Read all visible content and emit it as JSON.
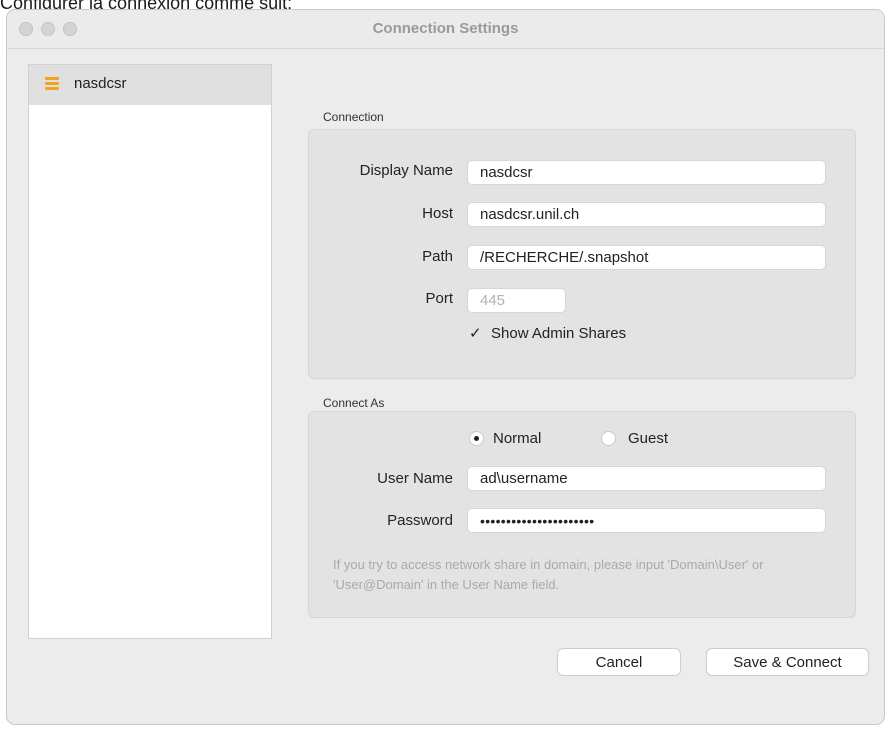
{
  "caption": "Configurer la connexion comme suit:",
  "window": {
    "title": "Connection Settings"
  },
  "sidebar": {
    "items": [
      {
        "label": "nasdcsr"
      }
    ]
  },
  "connection": {
    "section_label": "Connection",
    "display_name": {
      "label": "Display Name",
      "value": "nasdcsr"
    },
    "host": {
      "label": "Host",
      "value": "nasdcsr.unil.ch"
    },
    "path": {
      "label": "Path",
      "value": "/RECHERCHE/.snapshot"
    },
    "port": {
      "label": "Port",
      "placeholder": "445"
    },
    "show_admin_shares": {
      "label": "Show Admin Shares",
      "checked": true
    }
  },
  "connect_as": {
    "section_label": "Connect As",
    "options": [
      {
        "label": "Normal",
        "selected": true
      },
      {
        "label": "Guest",
        "selected": false
      }
    ],
    "user_name": {
      "label": "User Name",
      "value": "ad\\username"
    },
    "password": {
      "label": "Password",
      "value": "••••••••••••••••••••••"
    },
    "hint": "If you try to access network share in domain, please input 'Domain\\User' or 'User@Domain' in the User Name field."
  },
  "buttons": {
    "cancel": "Cancel",
    "save_connect": "Save & Connect"
  },
  "colors": {
    "accent_icon": "#f0a41b",
    "window_bg": "#ececec",
    "group_bg": "#e3e3e3"
  }
}
